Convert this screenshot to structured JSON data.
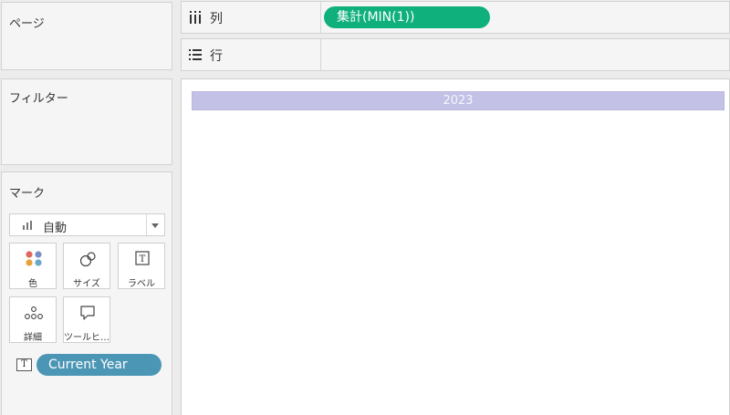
{
  "left": {
    "pages_title": "ページ",
    "filters_title": "フィルター",
    "marks_title": "マーク",
    "mark_type": "自動",
    "cards": {
      "color": "色",
      "size": "サイズ",
      "label": "ラベル",
      "detail": "詳細",
      "tooltip": "ツールヒ…"
    },
    "label_pill": "Current Year"
  },
  "shelves": {
    "columns_label": "列",
    "rows_label": "行",
    "column_pill": "集計(MIN(1))"
  },
  "view": {
    "header": "2023"
  },
  "colors": {
    "column_pill": "#10b07c",
    "label_pill": "#4c96b5",
    "header_bar": "#c3c1e6"
  }
}
